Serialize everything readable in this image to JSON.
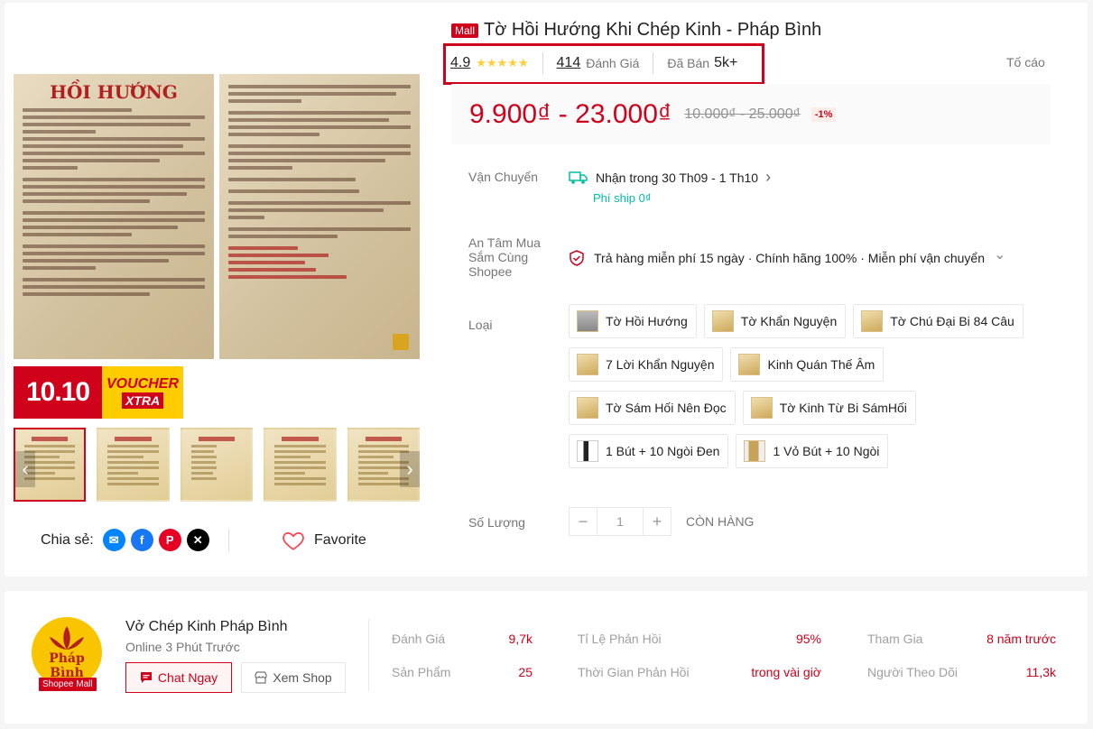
{
  "product": {
    "mall_badge": "Mall",
    "title": "Tờ Hồi Hướng Khi Chép Kinh - Pháp Bình",
    "rating": "4.9",
    "stars": "★★★★★",
    "review_count": "414",
    "review_label": "Đánh Giá",
    "sold_label": "Đã Bán",
    "sold_count": "5k+",
    "report": "Tố cáo",
    "price": "9.900₫ - 23.000₫",
    "old_price": "10.000₫ - 25.000₫",
    "discount": "-1%"
  },
  "gallery": {
    "page_title": "HỒI HƯỚNG",
    "promo_left": "10.10",
    "promo_right_1": "VOUCHER",
    "promo_right_2": "XTRA",
    "thumbs": [
      "thumb-1",
      "thumb-2",
      "thumb-3",
      "thumb-4",
      "thumb-5"
    ],
    "prev": "‹",
    "next": "›"
  },
  "share": {
    "label": "Chia sẻ:",
    "favorite": "Favorite"
  },
  "shipping": {
    "label": "Vận Chuyển",
    "delivery": "Nhận trong 30 Th09 - 1 Th10",
    "chevron": "›",
    "fee": "Phí ship 0₫"
  },
  "assurance": {
    "label": "An Tâm Mua Sắm Cùng Shopee",
    "text": "Trả hàng miễn phí 15 ngày · Chính hãng 100% · Miễn phí vận chuyển",
    "chevron": "⌄"
  },
  "variants": {
    "label": "Loại",
    "options": [
      "Tờ Hồi Hướng",
      "Tờ Khẩn Nguyện",
      "Tờ Chú Đại Bi 84 Câu",
      "7 Lời Khẩn Nguyện",
      "Kinh Quán Thế Âm",
      "Tờ Sám Hối Nên Đọc",
      "Tờ Kinh Từ Bi SámHối",
      "1 Bút + 10 Ngòi Đen",
      "1 Vỏ Bút + 10 Ngòi"
    ]
  },
  "quantity": {
    "label": "Số Lượng",
    "minus": "−",
    "value": "1",
    "plus": "+",
    "stock": "CÒN HÀNG"
  },
  "shop": {
    "logo_text": "Pháp Bình",
    "mall_tag": "Shopee Mall",
    "name": "Vở Chép Kinh Pháp Bình",
    "online": "Online 3 Phút Trước",
    "chat": "Chat Ngay",
    "view": "Xem Shop",
    "stats": {
      "rating_label": "Đánh Giá",
      "rating": "9,7k",
      "response_label": "Tỉ Lệ Phản Hồi",
      "response": "95%",
      "joined_label": "Tham Gia",
      "joined": "8 năm trước",
      "products_label": "Sản Phẩm",
      "products": "25",
      "time_label": "Thời Gian Phản Hồi",
      "time": "trong vài giờ",
      "followers_label": "Người Theo Dõi",
      "followers": "11,3k"
    }
  },
  "colors": {
    "accent": "#d0011b",
    "star": "#ffce3d",
    "teal": "#00bfa5"
  }
}
